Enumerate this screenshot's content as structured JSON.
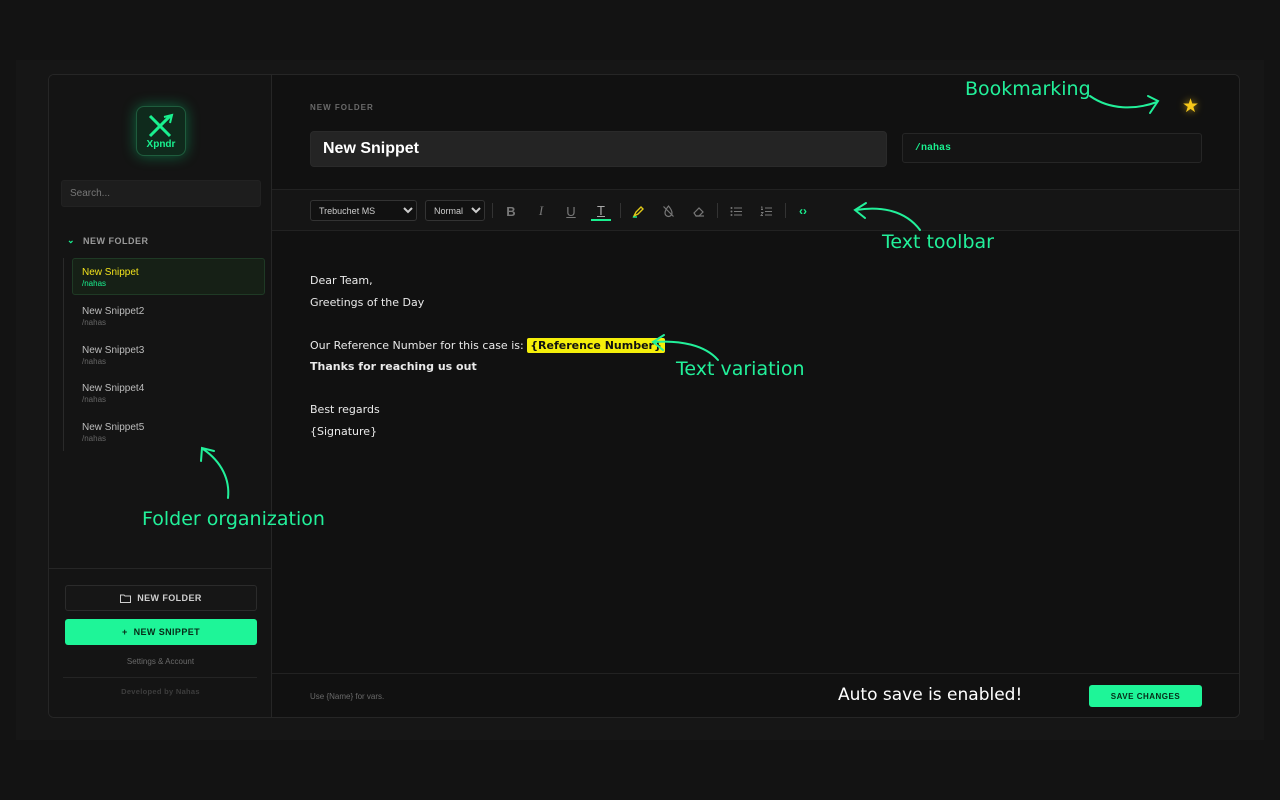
{
  "app": {
    "logo_text": "Xpndr"
  },
  "sidebar": {
    "search_placeholder": "Search...",
    "folder": {
      "name": "NEW FOLDER",
      "snippets": [
        {
          "name": "New Snippet",
          "shortcut": "/nahas",
          "active": true
        },
        {
          "name": "New Snippet2",
          "shortcut": "/nahas",
          "active": false
        },
        {
          "name": "New Snippet3",
          "shortcut": "/nahas",
          "active": false
        },
        {
          "name": "New Snippet4",
          "shortcut": "/nahas",
          "active": false
        },
        {
          "name": "New Snippet5",
          "shortcut": "/nahas",
          "active": false
        }
      ]
    },
    "new_folder_label": "NEW FOLDER",
    "new_snippet_label": "NEW SNIPPET",
    "settings_label": "Settings & Account",
    "developer_credit": "Developed by Nahas"
  },
  "main": {
    "breadcrumb": "NEW FOLDER",
    "title_value": "New Snippet",
    "shortcut_value": "/nahas",
    "toolbar": {
      "font_selected": "Trebuchet MS",
      "size_selected": "Normal"
    },
    "editor": {
      "line1": "Dear Team,",
      "line2": "Greetings of the Day",
      "line3_prefix": "Our Reference Number for this case is: ",
      "line3_variable": "{Reference Number}",
      "line4": "Thanks for reaching us out",
      "line5": "Best regards",
      "line6": "{Signature}"
    },
    "footer_hint": "Use {Name} for vars.",
    "save_label": "SAVE CHANGES"
  },
  "annotations": {
    "bookmarking": "Bookmarking",
    "text_toolbar": "Text toolbar",
    "text_variation": "Text variation",
    "folder_organization": "Folder organization",
    "auto_save": "Auto save is enabled!"
  },
  "colors": {
    "accent": "#1ef598",
    "highlight": "#f5ef0a",
    "star": "#f7c81a",
    "active_snippet_name": "#f2e21c"
  }
}
